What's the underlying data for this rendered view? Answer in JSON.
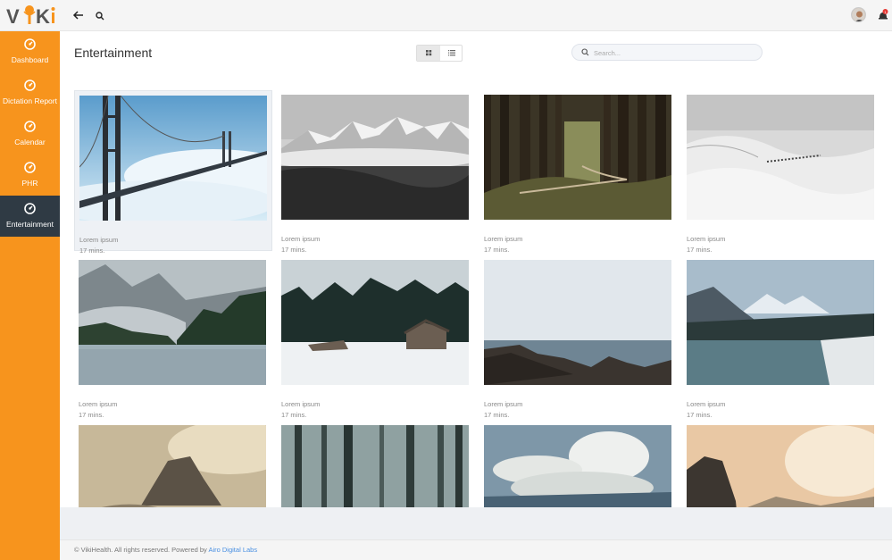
{
  "app": {
    "logo_text": "ViKi",
    "brand_color": "#f7941d",
    "sidebar_active_bg": "#2f3a44"
  },
  "topbar": {
    "back_icon": "arrow-left-icon",
    "search_icon": "search-icon",
    "notification_count": "1"
  },
  "sidebar": {
    "items": [
      {
        "label": "Dashboard",
        "icon": "dashboard-icon"
      },
      {
        "label": "Dictation Report",
        "icon": "dictation-icon"
      },
      {
        "label": "Calendar",
        "icon": "calendar-icon"
      },
      {
        "label": "PHR",
        "icon": "phr-icon"
      },
      {
        "label": "Entertainment",
        "icon": "entertainment-icon",
        "active": true
      }
    ]
  },
  "main": {
    "title": "Entertainment",
    "view_toggle": {
      "grid_icon": "grid-view-icon",
      "list_icon": "list-view-icon",
      "selected": "grid"
    },
    "search": {
      "placeholder": "Search...",
      "value": ""
    }
  },
  "cards": [
    {
      "title": "Lorem ipsum",
      "duration": "17 mins.",
      "image": "golden-gate-bridge-fog"
    },
    {
      "title": "Lorem ipsum",
      "duration": "17 mins.",
      "image": "snowy-mountain-range-bw"
    },
    {
      "title": "Lorem ipsum",
      "duration": "17 mins.",
      "image": "forest-path"
    },
    {
      "title": "Lorem ipsum",
      "duration": "17 mins.",
      "image": "snow-dunes-bw"
    },
    {
      "title": "Lorem ipsum",
      "duration": "17 mins.",
      "image": "misty-lake-mountains"
    },
    {
      "title": "Lorem ipsum",
      "duration": "17 mins.",
      "image": "snowy-cabin-forest"
    },
    {
      "title": "Lorem ipsum",
      "duration": "17 mins.",
      "image": "rocky-coast-sea"
    },
    {
      "title": "Lorem ipsum",
      "duration": "17 mins.",
      "image": "winter-lake-mountains"
    },
    {
      "title": "",
      "duration": "",
      "image": "half-dome-sunset"
    },
    {
      "title": "",
      "duration": "",
      "image": "foggy-forest"
    },
    {
      "title": "",
      "duration": "",
      "image": "clouds-over-valley"
    },
    {
      "title": "",
      "duration": "",
      "image": "cliffs-sunrise"
    }
  ],
  "footer": {
    "text": "© VikiHealth. All rights reserved. Powered by",
    "link": "Airo Digital Labs"
  }
}
